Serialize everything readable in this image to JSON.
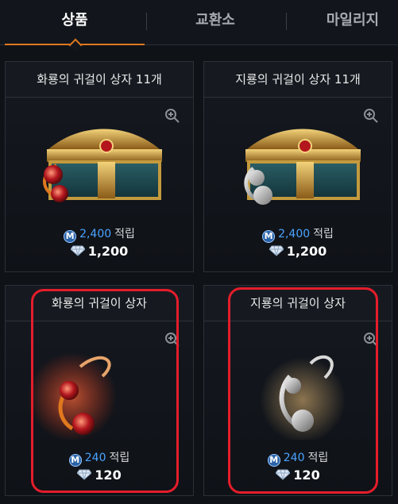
{
  "tabs": [
    {
      "label": "상품",
      "active": true
    },
    {
      "label": "교환소",
      "active": false
    },
    {
      "label": "마일리지",
      "active": false
    }
  ],
  "products": [
    {
      "title": "화룡의 귀걸이 상자 11개",
      "mileage": "2,400",
      "mileage_unit": "적립",
      "price": "1,200"
    },
    {
      "title": "지룡의 귀걸이 상자 11개",
      "mileage": "2,400",
      "mileage_unit": "적립",
      "price": "1,200"
    },
    {
      "title": "화룡의 귀걸이 상자",
      "mileage": "240",
      "mileage_unit": "적립",
      "price": "120"
    },
    {
      "title": "지룡의 귀걸이 상자",
      "mileage": "240",
      "mileage_unit": "적립",
      "price": "120"
    }
  ],
  "icons": {
    "zoom": "zoom-in-icon",
    "mileage": "mileage-coin-icon",
    "diamond": "diamond-icon"
  },
  "colors": {
    "accent": "#e0781e",
    "highlight": "#e41d2b",
    "mileage_text": "#4aa3ff"
  }
}
